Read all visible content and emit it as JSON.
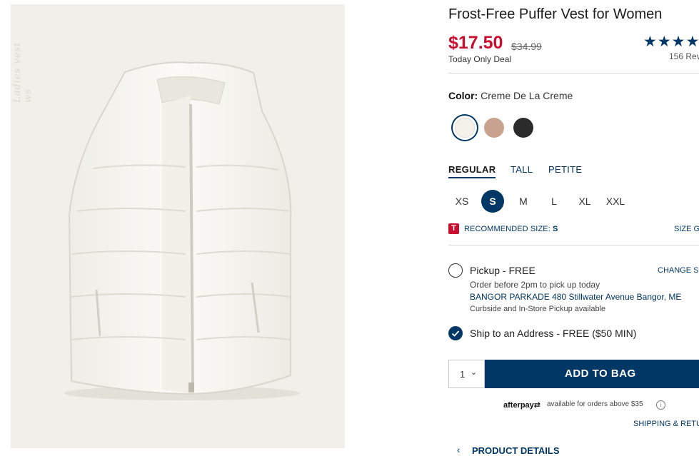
{
  "product": {
    "title": "Frost-Free Puffer Vest for Women",
    "image_alt": "White puffer vest",
    "watermark": "Ladies vest ws"
  },
  "pricing": {
    "sale_price": "$17.50",
    "original_price": "$34.99",
    "deal_label": "Today Only Deal",
    "sale_color": "#c8102e"
  },
  "rating": {
    "stars": "★★★★",
    "reviews": "156 Rev"
  },
  "color": {
    "label": "Color:",
    "selected": "Creme De La Creme",
    "swatches": [
      {
        "name": "Creme De La Creme",
        "hex": "#f3f1ea"
      },
      {
        "name": "Blush",
        "hex": "#c9a18f"
      },
      {
        "name": "Black",
        "hex": "#2b2b2b"
      }
    ]
  },
  "fit": {
    "tabs": [
      "REGULAR",
      "TALL",
      "PETITE"
    ],
    "selected": "REGULAR"
  },
  "sizes": {
    "options": [
      "XS",
      "S",
      "M",
      "L",
      "XL",
      "XXL"
    ],
    "selected": "S"
  },
  "recommendation": {
    "icon_letter": "T",
    "label": "RECOMMENDED SIZE:",
    "value": "S",
    "size_guide": "SIZE G"
  },
  "fulfillment": {
    "pickup": {
      "label": "Pickup - FREE",
      "change_store": "CHANGE ST",
      "time": "Order before 2pm to pick up today",
      "store": "BANGOR PARKADE 480 Stillwater Avenue  Bangor, ME",
      "note": "Curbside and In-Store Pickup available"
    },
    "ship": {
      "label": "Ship to an Address - FREE ($50 MIN)"
    }
  },
  "cart": {
    "quantity": "1",
    "add_to_bag": "ADD TO BAG"
  },
  "afterpay": {
    "logo": "afterpay",
    "text": "available for orders above $35",
    "info": "i"
  },
  "links": {
    "shipping_returns": "SHIPPING & RETU",
    "product_details": "PRODUCT DETAILS"
  },
  "colors": {
    "brand_navy": "#003764",
    "accent_red": "#c8102e"
  }
}
